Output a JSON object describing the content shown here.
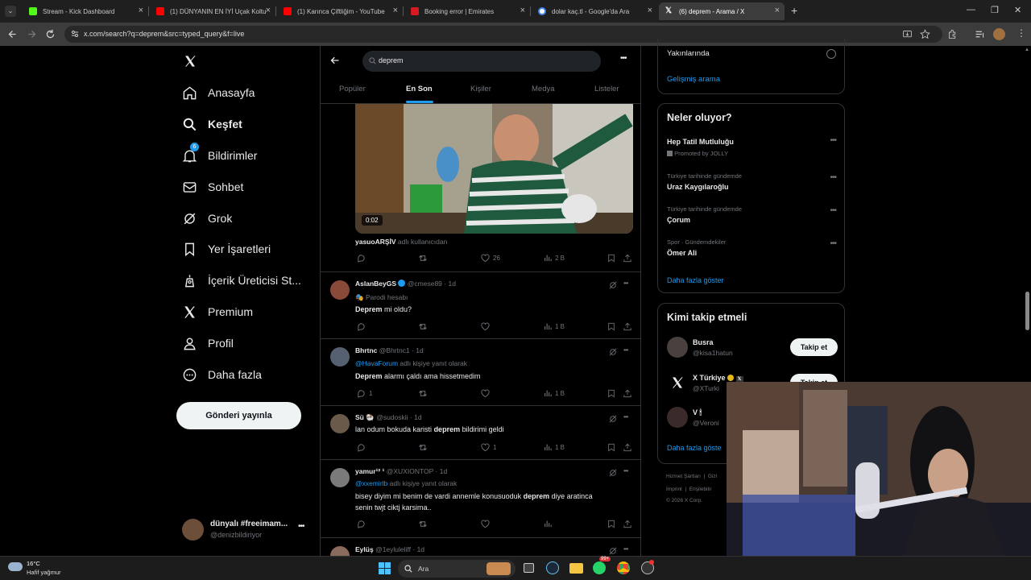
{
  "browser": {
    "tabs": [
      {
        "title": "Stream - Kick Dashboard",
        "favicon_color": "#53fc18",
        "active": false
      },
      {
        "title": "(1) DÜNYANIN EN İYİ Uçak Koltu",
        "favicon_color": "#ff0000",
        "active": false
      },
      {
        "title": "(1) Karınca Çiftliğim - YouTube",
        "favicon_color": "#ff0000",
        "active": false
      },
      {
        "title": "Booking error | Emirates",
        "favicon_color": "#d71921",
        "active": false
      },
      {
        "title": "dolar kaç.tl - Google'da Ara",
        "favicon_color": "#4285f4",
        "active": false
      },
      {
        "title": "(6) deprem - Arama / X",
        "favicon_color": "#000000",
        "active": true
      }
    ],
    "url": "x.com/search?q=deprem&src=typed_query&f=live"
  },
  "nav": {
    "items": [
      {
        "label": "Anasayfa",
        "icon": "home-icon"
      },
      {
        "label": "Keşfet",
        "icon": "search-icon",
        "bold": true
      },
      {
        "label": "Bildirimler",
        "icon": "bell-icon",
        "badge": "6"
      },
      {
        "label": "Sohbet",
        "icon": "mail-icon"
      },
      {
        "label": "Grok",
        "icon": "grok-icon"
      },
      {
        "label": "Yer İşaretleri",
        "icon": "bookmark-icon"
      },
      {
        "label": "İçerik Üreticisi St...",
        "icon": "creator-icon"
      },
      {
        "label": "Premium",
        "icon": "x-logo-icon"
      },
      {
        "label": "Profil",
        "icon": "person-icon"
      },
      {
        "label": "Daha fazla",
        "icon": "more-circle-icon"
      }
    ],
    "post_button": "Gönderi yayınla",
    "account": {
      "name": "dünyalı #freeimam...",
      "handle": "@denizbildiriyor"
    }
  },
  "search": {
    "query": "deprem",
    "tabs": [
      "Popüler",
      "En Son",
      "Kişiler",
      "Medya",
      "Listeler"
    ],
    "active_tab": "En Son"
  },
  "feed": {
    "video_post": {
      "duration": "0:02",
      "from_user": "yasuoARŞİV",
      "from_suffix": "adlı kullanıcıdan",
      "likes": "26",
      "views": "2 B"
    },
    "posts": [
      {
        "name": "AslanBeyGS",
        "handle": "@cmese89",
        "time": "1d",
        "verified": true,
        "sub": "Parodi hesabı",
        "text_bold": "Deprem",
        "text_rest": " mi oldu?",
        "replies": "",
        "likes": "",
        "views": "1 B"
      },
      {
        "name": "Bhrtnc",
        "handle": "@Bhrtnc1",
        "time": "1d",
        "reply_to": "@HavaForum",
        "reply_suffix": "adlı kişiye yanıt olarak",
        "text_bold": "Deprem",
        "text_rest": " alarmı çaldı ama hissetmedim",
        "replies": "1",
        "likes": "",
        "views": "1 B"
      },
      {
        "name": "Sü 🐏",
        "handle": "@sudoskii",
        "time": "1d",
        "text_pre": "lan odum bokuda karisti ",
        "text_bold": "deprem",
        "text_rest": " bildirimi geldi",
        "replies": "",
        "likes": "1",
        "views": "1 B"
      },
      {
        "name": "yamur¹² ¹",
        "handle": "@XUXIONTOP",
        "time": "1d",
        "reply_to": "@xxemirlb",
        "reply_suffix": "adlı kişiye yanıt olarak",
        "text_pre": "bisey diyim mi benim de vardi annemle konusuoduk ",
        "text_bold": "deprem",
        "text_rest": " diye aratinca",
        "text_line2": "senin twjt ciktj karsima..",
        "replies": "",
        "likes": "",
        "views": ""
      },
      {
        "name": "Eylüş",
        "handle": "@1eyluleliff",
        "time": "1d"
      }
    ]
  },
  "sidebar": {
    "location_option": "Yakınlarında",
    "advanced_search": "Gelişmiş arama",
    "trends_title": "Neler oluyor?",
    "trends": [
      {
        "meta": "",
        "title": "Hep Tatil Mutluluğu",
        "promoted": "Promoted by JOLLY"
      },
      {
        "meta": "Türkiye tarihinde gündemde",
        "title": "Uraz Kaygılaroğlu"
      },
      {
        "meta": "Türkiye tarihinde gündemde",
        "title": "Çorum"
      },
      {
        "meta": "Spor · Gündemdekiler",
        "title": "Ömer Ali"
      }
    ],
    "show_more": "Daha fazla göster",
    "follow_title": "Kimi takip etmeli",
    "follow": [
      {
        "name": "Busra",
        "handle": "@kisa1hatun",
        "button": "Takip et"
      },
      {
        "name": "X Türkiye",
        "handle": "@XTurki",
        "button": "Takip et"
      },
      {
        "name": "V 🕯",
        "handle": "@Veroni",
        "button": ""
      }
    ],
    "follow_more": "Daha fazla göste",
    "footer": [
      "Hizmet Şartları",
      "Gizl",
      "İmprint",
      "Erişilebilir",
      "© 2026 X Corp."
    ]
  },
  "taskbar": {
    "temperature": "16°C",
    "weather": "Hafif yağmur",
    "search_placeholder": "Ara",
    "badge": "99+"
  },
  "colors": {
    "accent": "#1d9bf0",
    "background": "#000000",
    "border": "#2f3336",
    "muted": "#71767b"
  }
}
